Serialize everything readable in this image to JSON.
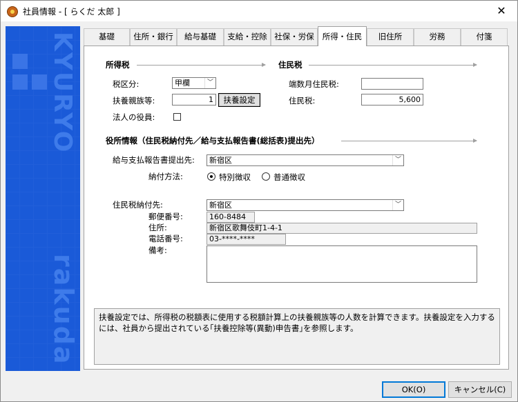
{
  "window": {
    "title": "社員情報 - [ らくだ 太郎 ]",
    "close_symbol": "✕"
  },
  "sidebar": {
    "word_top": "KYURYO",
    "word_bottom": "rakuda"
  },
  "tabs": [
    {
      "label": "基礎"
    },
    {
      "label": "住所・銀行"
    },
    {
      "label": "給与基礎"
    },
    {
      "label": "支給・控除"
    },
    {
      "label": "社保・労保"
    },
    {
      "label": "所得・住民",
      "active": true
    },
    {
      "label": "旧住所"
    },
    {
      "label": "労務"
    },
    {
      "label": "付箋"
    }
  ],
  "income_tax": {
    "section_title": "所得税",
    "tax_class_label": "税区分:",
    "tax_class_value": "甲欄",
    "dependents_label": "扶養親族等:",
    "dependents_value": "1",
    "dependents_button": "扶養設定",
    "corporate_officer_label": "法人の役員:"
  },
  "resident_tax": {
    "section_title": "住民税",
    "fraction_month_label": "端数月住民税:",
    "fraction_month_value": "",
    "resident_tax_label": "住民税:",
    "resident_tax_value": "5,600"
  },
  "office": {
    "section_title": "役所情報（住民税納付先／給与支払報告書(総括表)提出先）",
    "report_dest_label": "給与支払報告書提出先:",
    "report_dest_value": "新宿区",
    "payment_method_label": "納付方法:",
    "payment_options": [
      {
        "label": "特別徴収",
        "checked": true
      },
      {
        "label": "普通徴収",
        "checked": false
      }
    ],
    "payee_label": "住民税納付先:",
    "payee_value": "新宿区",
    "postal_label": "郵便番号:",
    "postal_value": "160-8484",
    "address_label": "住所:",
    "address_value": "新宿区歌舞伎町1-4-1",
    "phone_label": "電話番号:",
    "phone_value": "03-****-****",
    "memo_label": "備考:",
    "memo_value": ""
  },
  "info_text": "扶養設定では、所得税の税額表に使用する税額計算上の扶養親族等の人数を計算できます。扶養設定を入力するには、社員から提出されている｢扶養控除等(異動)申告書｣を参照します。",
  "footer": {
    "ok_label": "OK(O)",
    "cancel_label": "キャンセル(C)"
  }
}
